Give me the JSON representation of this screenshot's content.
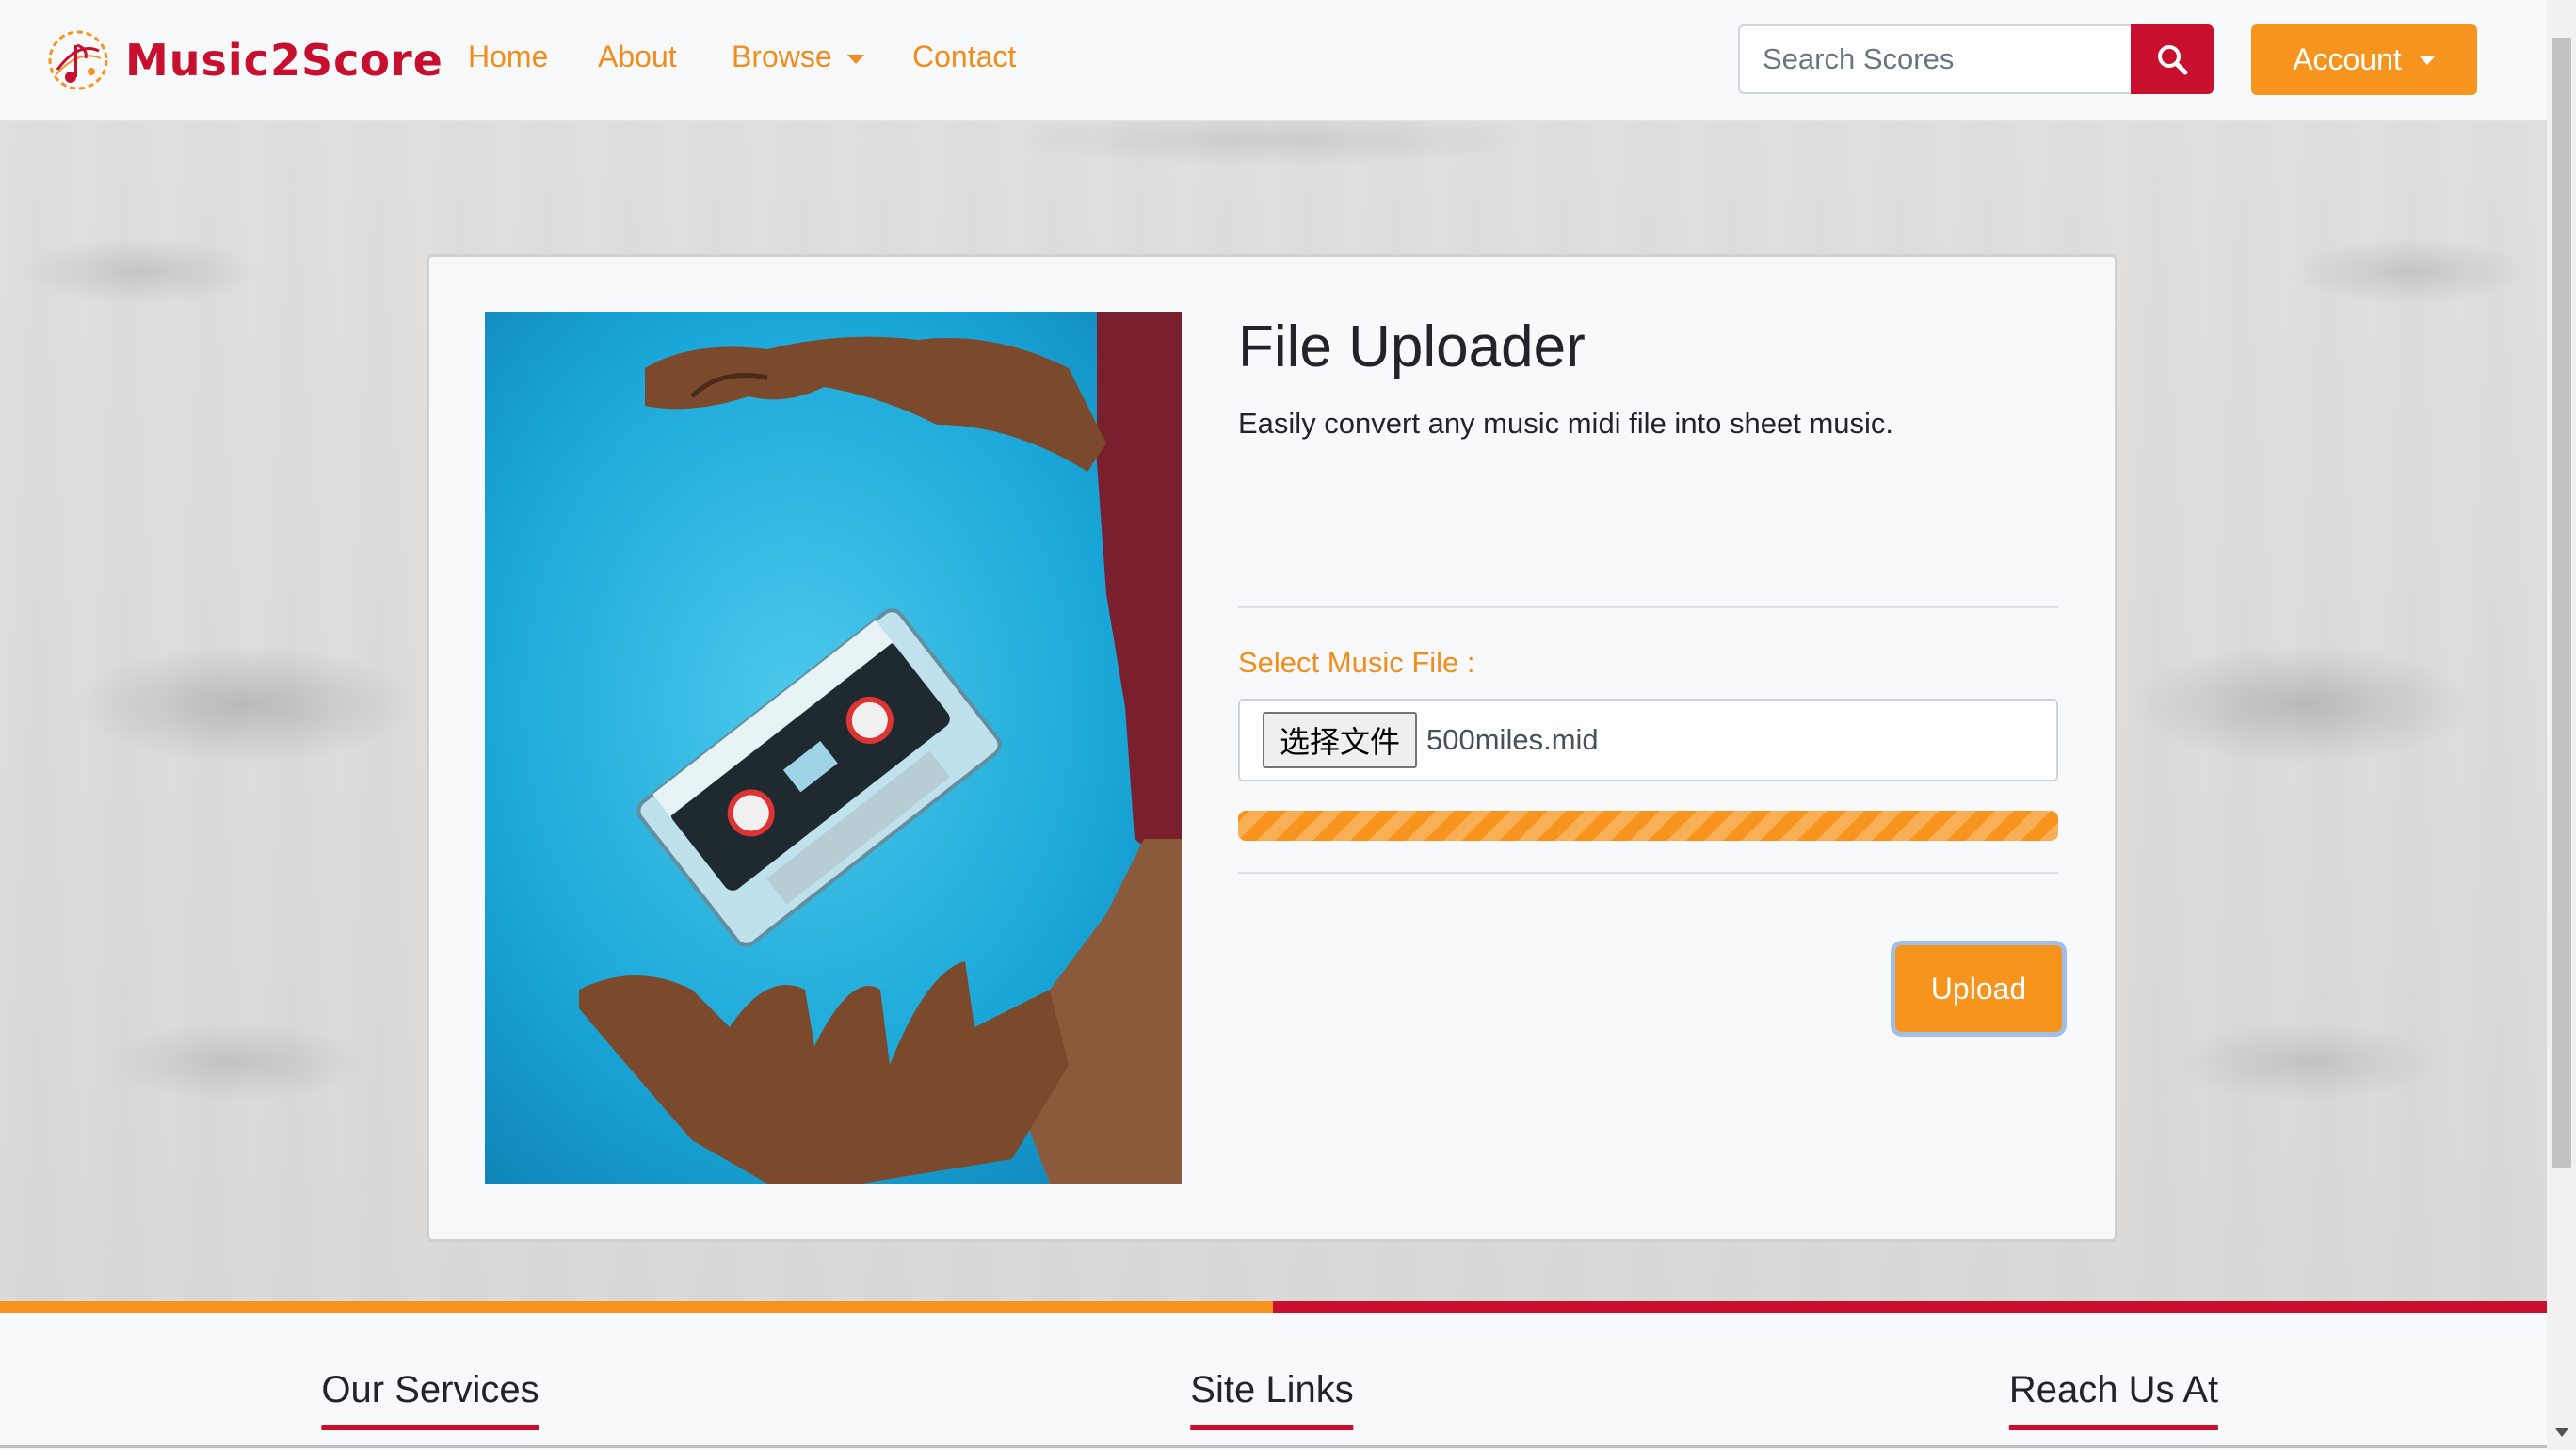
{
  "navbar": {
    "brand": "Music2Score",
    "links": [
      {
        "label": "Home"
      },
      {
        "label": "About"
      },
      {
        "label": "Browse"
      },
      {
        "label": "Contact"
      }
    ],
    "search_placeholder": "Search Scores",
    "account_label": "Account"
  },
  "uploader": {
    "title": "File Uploader",
    "subtitle": "Easily convert any music midi file into sheet music.",
    "select_label": "Select Music File :",
    "choose_button": "选择文件",
    "file_name": "500miles.mid",
    "progress_percent": 100,
    "upload_button": "Upload"
  },
  "footer": {
    "headings": [
      "Our Services",
      "Site Links",
      "Reach Us At"
    ]
  },
  "colors": {
    "accent_orange": "#f7941d",
    "brand_red": "#c8102e"
  },
  "icons": {
    "search": "search-icon",
    "logo": "music-note-logo-icon",
    "dropdown": "caret-down-icon"
  }
}
